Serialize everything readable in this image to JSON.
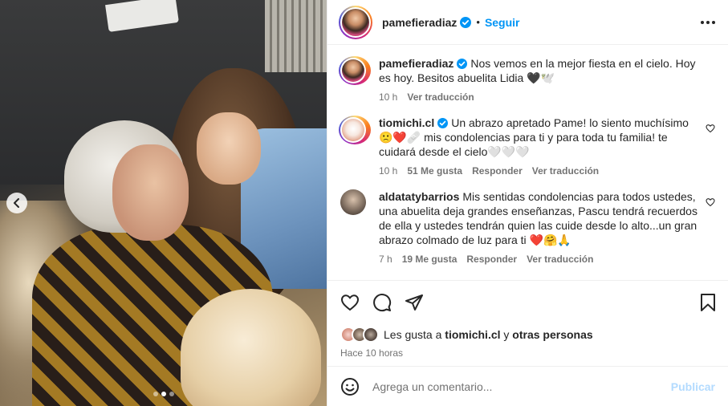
{
  "post": {
    "author": "pamefieradiaz",
    "follow_label": "Seguir",
    "separator": "•"
  },
  "comments": [
    {
      "user": "pamefieradiaz",
      "verified": true,
      "text": "Nos vemos en la mejor fiesta en el cielo. Hoy es hoy. Besitos abuelita Lidia 🖤🕊️",
      "time": "10 h",
      "translate": "Ver traducción"
    },
    {
      "user": "tiomichi.cl",
      "verified": true,
      "text": "Un abrazo apretado Pame! lo siento muchísimo 🙁❤️🩹 mis condolencias para ti y para toda tu familia! te cuidará desde el cielo🤍🤍🤍",
      "time": "10 h",
      "likes": "51 Me gusta",
      "reply": "Responder",
      "translate": "Ver traducción"
    },
    {
      "user": "aldatatybarrios",
      "verified": false,
      "text": "Mis sentidas condolencias para todos ustedes, una abuelita deja grandes enseñanzas, Pascu tendrá recuerdos de ella y ustedes tendrán quien las cuide desde lo alto...un gran abrazo colmado de luz para ti ❤️🤗🙏",
      "time": "7 h",
      "likes": "19 Me gusta",
      "reply": "Responder",
      "translate": "Ver traducción"
    }
  ],
  "likes_line": {
    "prefix": "Les gusta a",
    "user": "tiomichi.cl",
    "joiner": "y",
    "others": "otras personas"
  },
  "posted_ago": "Hace 10 horas",
  "add_comment": {
    "placeholder": "Agrega un comentario...",
    "publish_label": "Publicar"
  },
  "carousel": {
    "slides": 3,
    "active_index": 0
  },
  "colors": {
    "accent": "#0095f6",
    "publish_disabled": "#b3dbff",
    "muted": "#737373",
    "text": "#262626"
  }
}
